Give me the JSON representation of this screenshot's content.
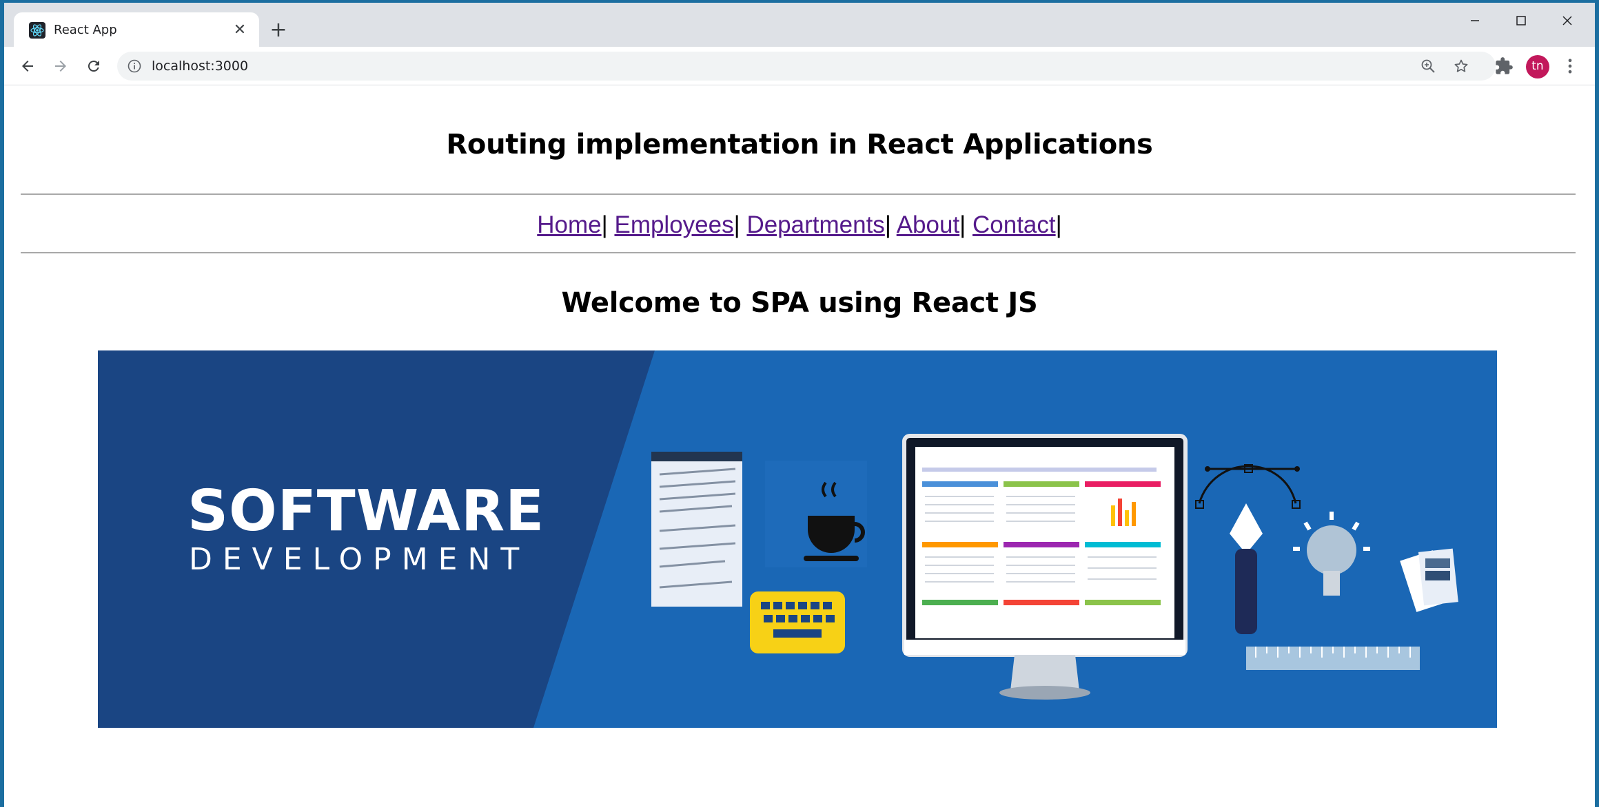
{
  "browser": {
    "tab_title": "React App",
    "tab_close": "✕",
    "new_tab": "+",
    "url": "localhost:3000",
    "avatar_initials": "tn"
  },
  "page": {
    "title": "Routing implementation in React Applications",
    "welcome": "Welcome to SPA using React JS",
    "nav": [
      {
        "label": "Home"
      },
      {
        "label": "Employees"
      },
      {
        "label": "Departments"
      },
      {
        "label": "About"
      },
      {
        "label": "Contact"
      }
    ],
    "separator": "|",
    "banner": {
      "title": "SOFTWARE",
      "subtitle": "DEVELOPMENT"
    }
  },
  "colors": {
    "link": "#551a8b",
    "banner_dark": "#1a4583",
    "banner_light": "#1a67b5",
    "avatar": "#c2185b"
  },
  "icons": [
    "react-icon",
    "close-icon",
    "plus-icon",
    "minimize-icon",
    "maximize-icon",
    "window-close-icon",
    "back-icon",
    "forward-icon",
    "reload-icon",
    "info-icon",
    "zoom-icon",
    "star-icon",
    "puzzle-icon",
    "kebab-menu-icon"
  ]
}
